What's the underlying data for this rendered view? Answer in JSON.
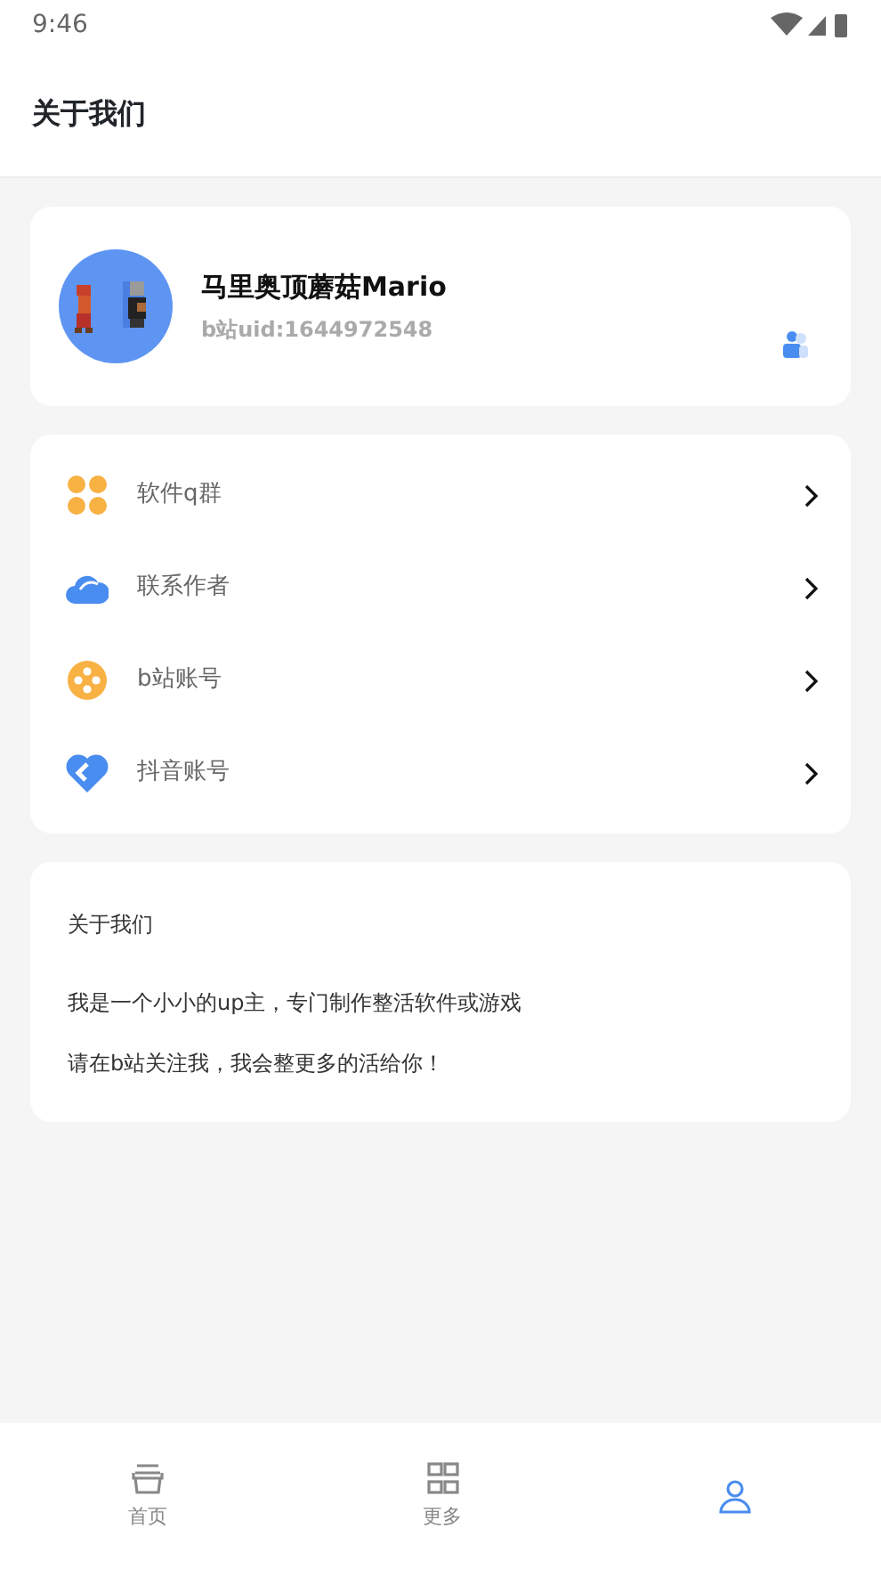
{
  "status_bar": {
    "time": "9:46"
  },
  "header": {
    "title": "关于我们"
  },
  "profile": {
    "name": "马里奥顶蘑菇Mario",
    "uid": "b站uid:1644972548"
  },
  "links": [
    {
      "kind": "clover",
      "label": "软件q群",
      "color": "#f8b143"
    },
    {
      "kind": "cloud",
      "label": "联系作者",
      "color": "#4a8df0"
    },
    {
      "kind": "reel",
      "label": "b站账号",
      "color": "#f8b143"
    },
    {
      "kind": "heart",
      "label": "抖音账号",
      "color": "#4a8df0"
    }
  ],
  "about": {
    "title": "关于我们",
    "lines": [
      "我是一个小小的up主，专门制作整活软件或游戏",
      "请在b站关注我，我会整更多的活给你！"
    ]
  },
  "tabs": [
    {
      "kind": "home",
      "label": "首页",
      "selected": false
    },
    {
      "kind": "grid",
      "label": "更多",
      "selected": false
    },
    {
      "kind": "person",
      "selected": true
    }
  ]
}
